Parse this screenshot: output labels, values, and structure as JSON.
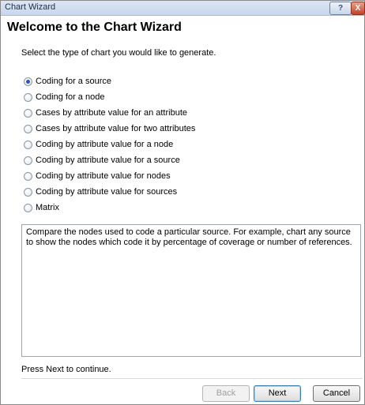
{
  "window": {
    "title": "Chart Wizard",
    "help_icon": "?",
    "close_icon": "X"
  },
  "header": {
    "title": "Welcome to the Chart Wizard"
  },
  "instruction": "Select the type of chart you would like to generate.",
  "options": [
    {
      "label": "Coding for a source",
      "selected": true
    },
    {
      "label": "Coding for a node",
      "selected": false
    },
    {
      "label": "Cases by attribute value for an attribute",
      "selected": false
    },
    {
      "label": "Cases by attribute value for two attributes",
      "selected": false
    },
    {
      "label": "Coding by attribute value for a node",
      "selected": false
    },
    {
      "label": "Coding by attribute value for a source",
      "selected": false
    },
    {
      "label": "Coding by attribute value for nodes",
      "selected": false
    },
    {
      "label": "Coding by attribute value for sources",
      "selected": false
    },
    {
      "label": "Matrix",
      "selected": false
    }
  ],
  "description": "Compare the nodes used to code a particular source. For example, chart any source to show the nodes which code it by percentage of coverage or number of references.",
  "footer": {
    "hint": "Press Next to continue.",
    "back_label": "Back",
    "next_label": "Next",
    "cancel_label": "Cancel"
  }
}
